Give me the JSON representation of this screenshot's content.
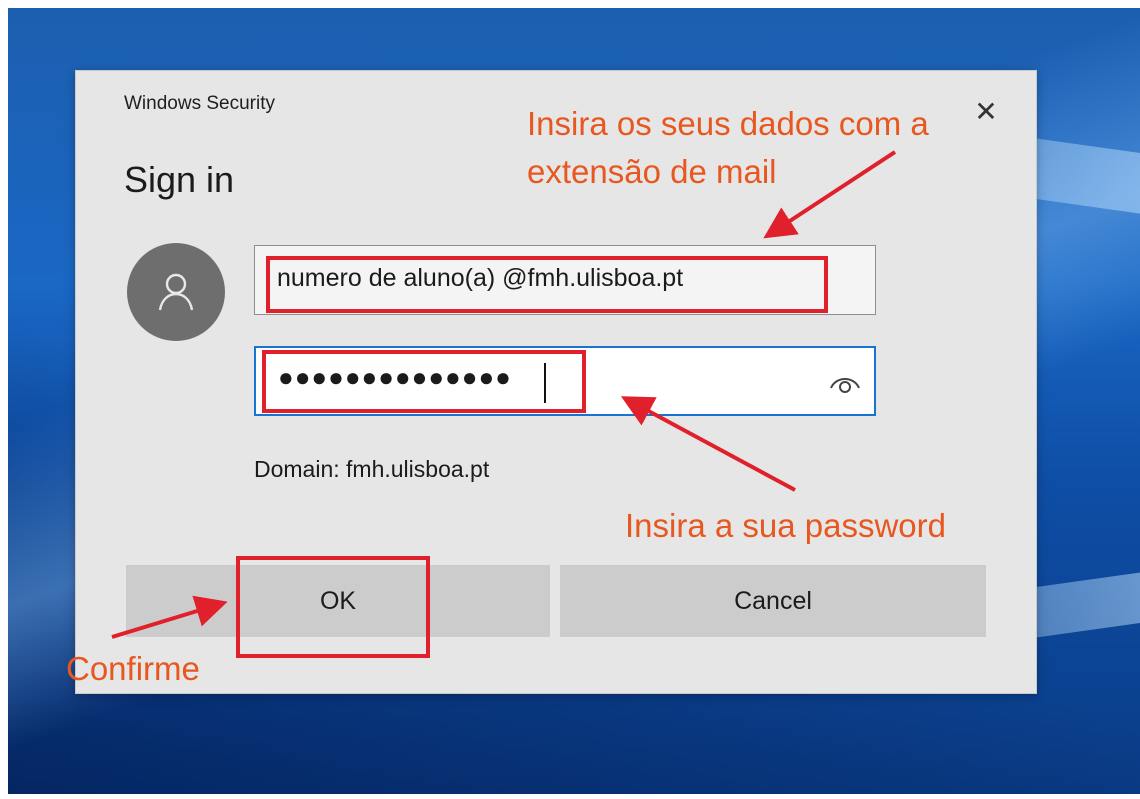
{
  "dialog": {
    "title": "Windows Security",
    "close_glyph": "✕",
    "heading": "Sign in",
    "username_value": "numero de aluno(a) @fmh.ulisboa.pt",
    "password_masked": "●●●●●●●●●●●●●●",
    "domain_text": "Domain: fmh.ulisboa.pt",
    "ok_label": "OK",
    "cancel_label": "Cancel"
  },
  "annotations": {
    "credentials_hint": "Insira os seus dados com a extensão de mail",
    "password_hint": "Insira a sua password",
    "confirm_hint": "Confirme"
  },
  "icons": {
    "avatar": "user-icon",
    "reveal": "eye-icon",
    "close": "close-icon"
  },
  "colors": {
    "annotation_text": "#e8571f",
    "annotation_marks": "#e0202a",
    "focus_border": "#1874d2",
    "desktop_blue": "#1a67c4"
  }
}
